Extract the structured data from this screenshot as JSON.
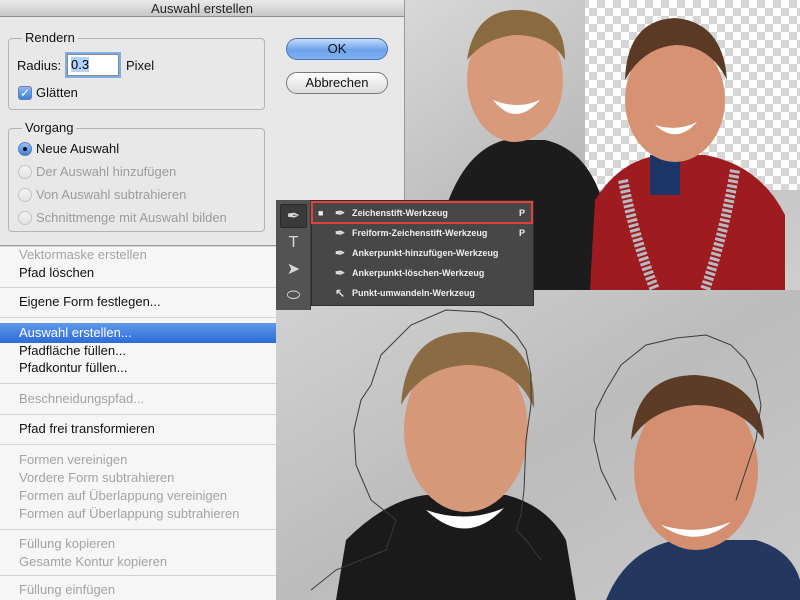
{
  "dialog": {
    "title": "Auswahl erstellen",
    "render_group": "Rendern",
    "radius_label": "Radius:",
    "radius_value": "0.3",
    "radius_unit": "Pixel",
    "smooth_label": "Glätten",
    "smooth_checked": true,
    "operation_group": "Vorgang",
    "operations": [
      {
        "label": "Neue Auswahl",
        "selected": true,
        "enabled": true
      },
      {
        "label": "Der Auswahl hinzufügen",
        "selected": false,
        "enabled": false
      },
      {
        "label": "Von Auswahl subtrahieren",
        "selected": false,
        "enabled": false
      },
      {
        "label": "Schnittmenge mit Auswahl bilden",
        "selected": false,
        "enabled": false
      }
    ],
    "ok_label": "OK",
    "cancel_label": "Abbrechen"
  },
  "context_menu": {
    "items": [
      {
        "label": "Vektormaske erstellen",
        "enabled": false
      },
      {
        "label": "Pfad löschen",
        "enabled": true
      },
      {
        "label": "Eigene Form festlegen...",
        "enabled": true
      },
      {
        "label": "Auswahl erstellen...",
        "enabled": true,
        "highlighted": true
      },
      {
        "label": "Pfadfläche füllen...",
        "enabled": true
      },
      {
        "label": "Pfadkontur füllen...",
        "enabled": true
      },
      {
        "label": "Beschneidungspfad...",
        "enabled": false
      },
      {
        "label": "Pfad frei transformieren",
        "enabled": true
      },
      {
        "label": "Formen vereinigen",
        "enabled": false
      },
      {
        "label": "Vordere Form subtrahieren",
        "enabled": false
      },
      {
        "label": "Formen auf Überlappung vereinigen",
        "enabled": false
      },
      {
        "label": "Formen auf Überlappung subtrahieren",
        "enabled": false
      },
      {
        "label": "Füllung kopieren",
        "enabled": false
      },
      {
        "label": "Gesamte Kontur kopieren",
        "enabled": false
      },
      {
        "label": "Füllung einfügen",
        "enabled": false
      }
    ]
  },
  "toolbar": {
    "tools": [
      {
        "name": "pen-tool-icon",
        "glyph": "✒",
        "active": true
      },
      {
        "name": "type-tool-icon",
        "glyph": "T",
        "active": false
      },
      {
        "name": "path-selection-icon",
        "glyph": "➤",
        "active": false
      },
      {
        "name": "ellipse-tool-icon",
        "glyph": "⬭",
        "active": false
      }
    ]
  },
  "pen_flyout": {
    "items": [
      {
        "label": "Zeichenstift-Werkzeug",
        "shortcut": "P",
        "selected": true
      },
      {
        "label": "Freiform-Zeichenstift-Werkzeug",
        "shortcut": "P",
        "selected": false
      },
      {
        "label": "Ankerpunkt-hinzufügen-Werkzeug",
        "shortcut": "",
        "selected": false
      },
      {
        "label": "Ankerpunkt-löschen-Werkzeug",
        "shortcut": "",
        "selected": false
      },
      {
        "label": "Punkt-umwandeln-Werkzeug",
        "shortcut": "",
        "selected": false
      }
    ]
  },
  "colors": {
    "menu_highlight": "#2c6ad8",
    "flyout_highlight_border": "#e2403b",
    "path_outline": "#3a3a3a"
  }
}
